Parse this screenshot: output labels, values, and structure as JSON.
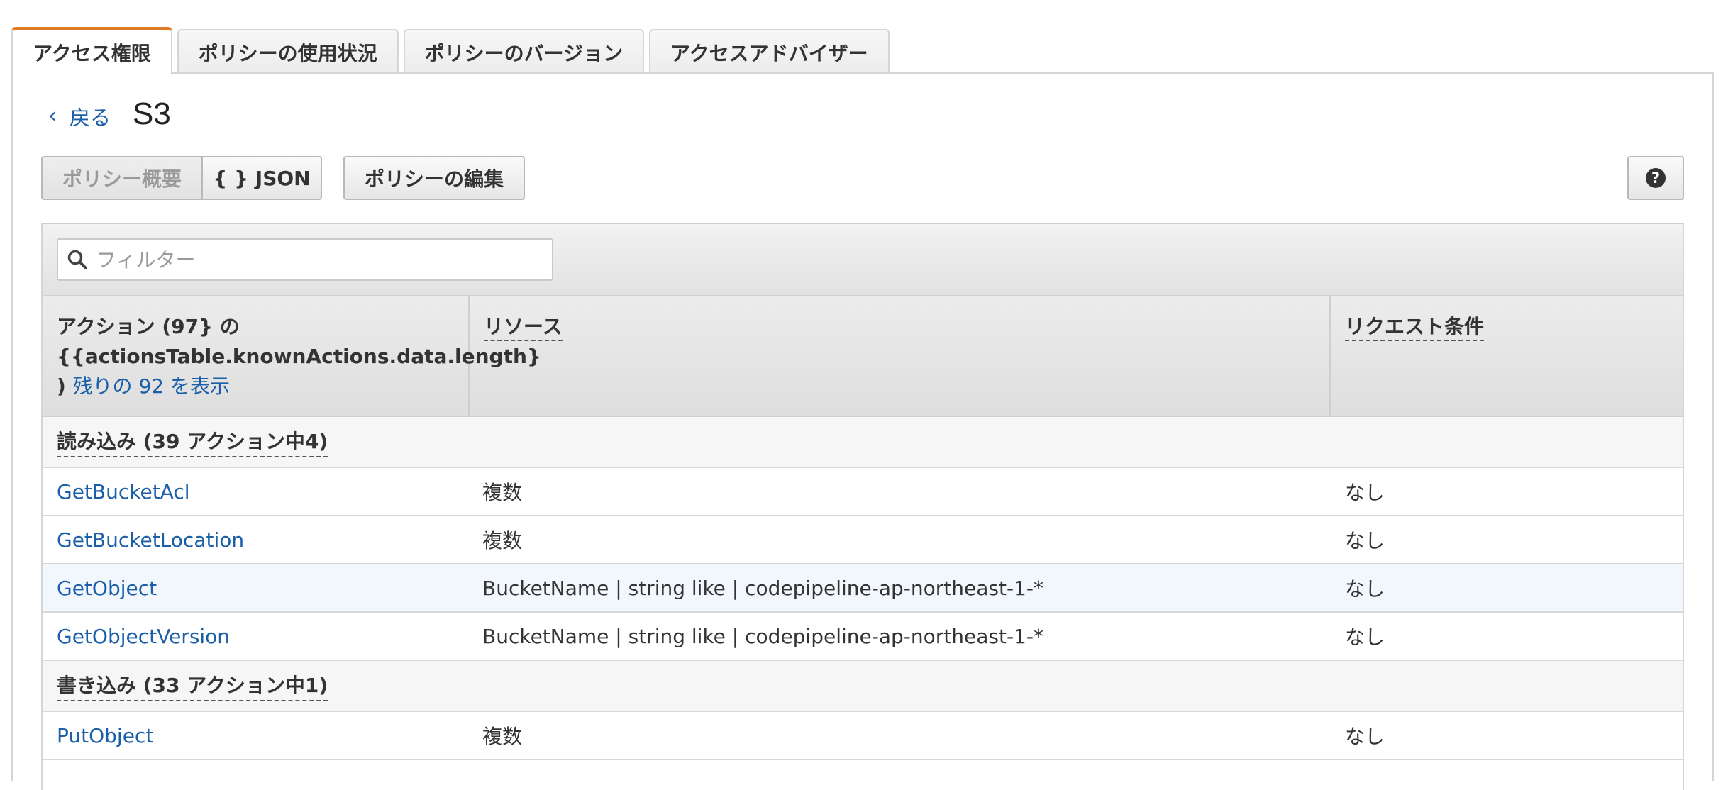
{
  "tabs": [
    {
      "label": "アクセス権限",
      "active": true
    },
    {
      "label": "ポリシーの使用状況",
      "active": false
    },
    {
      "label": "ポリシーのバージョン",
      "active": false
    },
    {
      "label": "アクセスアドバイザー",
      "active": false
    }
  ],
  "nav": {
    "back_label": "戻る",
    "title": "S3"
  },
  "toolbar": {
    "summary_label": "ポリシー概要",
    "json_label": "{ } JSON",
    "edit_label": "ポリシーの編集",
    "help_label": "?"
  },
  "filter": {
    "placeholder": "フィルター"
  },
  "table": {
    "header": {
      "action_line1": "アクション (97} の",
      "action_line2": "{{actionsTable.knownActions.data.length}",
      "action_line3_prefix": ")",
      "action_show_more": "残りの 92 を表示",
      "resource": "リソース",
      "condition": "リクエスト条件"
    },
    "groups": [
      {
        "label": "読み込み (39 アクション中4)",
        "rows": [
          {
            "action": "GetBucketAcl",
            "resource": "複数",
            "condition": "なし"
          },
          {
            "action": "GetBucketLocation",
            "resource": "複数",
            "condition": "なし"
          },
          {
            "action": "GetObject",
            "resource": "BucketName | string like | codepipeline-ap-northeast-1-*",
            "condition": "なし"
          },
          {
            "action": "GetObjectVersion",
            "resource": "BucketName | string like | codepipeline-ap-northeast-1-*",
            "condition": "なし"
          }
        ]
      },
      {
        "label": "書き込み (33 アクション中1)",
        "rows": [
          {
            "action": "PutObject",
            "resource": "複数",
            "condition": "なし"
          }
        ]
      }
    ]
  },
  "colors": {
    "link": "#1a5fa8",
    "active_tab_accent": "#e07b24",
    "highlight_row": "#f1f7fc"
  }
}
